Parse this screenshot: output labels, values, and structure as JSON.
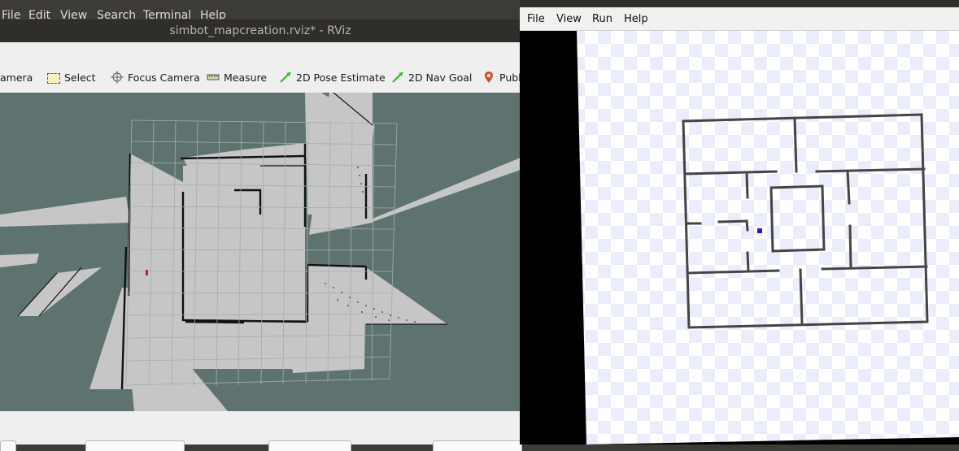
{
  "rviz": {
    "menu": [
      "File",
      "Edit",
      "View",
      "Search",
      "Terminal",
      "Help"
    ],
    "title": "simbot_mapcreation.rviz* - RViz",
    "tools": {
      "camera": "amera",
      "select": "Select",
      "focus_camera": "Focus Camera",
      "measure": "Measure",
      "pose_estimate": "2D Pose Estimate",
      "nav_goal": "2D Nav Goal",
      "publish": "Publi"
    }
  },
  "stage": {
    "menu": [
      "File",
      "View",
      "Run",
      "Help"
    ]
  },
  "colors": {
    "map_unknown": "#5e7370",
    "map_free": "#c6c6c6",
    "map_wall": "#111111",
    "grid": "#a9b3b0",
    "robot_rviz": "#c02020",
    "robot_stage": "#1a1ae0",
    "stage_walls": "#444444"
  }
}
